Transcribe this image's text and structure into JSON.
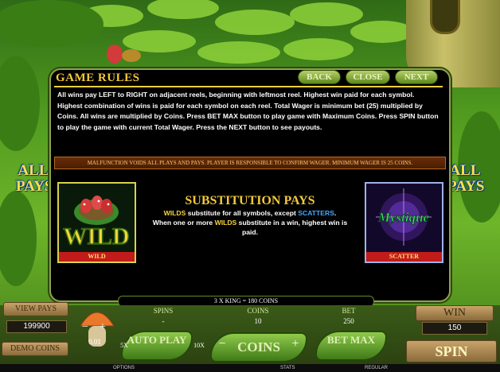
{
  "window": {
    "title": ""
  },
  "side": {
    "left_label": "ALL PAYS",
    "right_label": "ALL PAYS"
  },
  "rules": {
    "title": "GAME RULES",
    "nav": {
      "back": "BACK",
      "close": "CLOSE",
      "next": "NEXT"
    },
    "body": "All wins pay LEFT to RIGHT on adjacent reels, beginning with leftmost reel. Highest win paid for each symbol. Highest combination of wins is paid for each symbol on each reel. Total Wager is minimum bet (25) multiplied by Coins. All wins are multiplied by Coins. Press BET MAX button to play game with Maximum Coins. Press SPIN button to play the game with current Total Wager. Press the NEXT button to see payouts.",
    "malfunction": "MALFUNCTION VOIDS ALL PLAYS AND PAYS. PLAYER IS RESPONSIBLE TO CONFIRM WAGER. MINIMUM WAGER IS 25 COINS.",
    "wild_symbol": {
      "label": "WILD",
      "art_text": "WILD"
    },
    "scatter_symbol": {
      "label": "SCATTER",
      "art_text": "Mystique"
    },
    "substitution": {
      "title": "SUBSTITUTION PAYS",
      "line1_a": "WILDS",
      "line1_b": " substitute for all symbols, except ",
      "line1_c": "SCATTERS",
      "line1_d": ".",
      "line2_a": "When one or more ",
      "line2_b": "WILDS",
      "line2_c": " substitute in a win, highest win is paid."
    }
  },
  "footer_info": "3 X KING = 180 COINS",
  "controls": {
    "view_pays": "VIEW PAYS",
    "balance": "199900",
    "demo_coins": "DEMO COINS",
    "coin_value": "0.01",
    "spins_label": "SPINS",
    "spins_value": "-",
    "coins_label": "COINS",
    "coins_value": "10",
    "bet_label": "BET",
    "bet_value": "250",
    "win_label": "WIN",
    "win_value": "150",
    "auto_play": "AUTO PLAY",
    "x5": "5X",
    "x10": "10X",
    "coins_button": "COINS",
    "minus": "−",
    "plus": "+",
    "bet_max": "BET MAX",
    "spin": "SPIN"
  },
  "status_bar": {
    "options": "OPTIONS",
    "stats": "STATS",
    "regular": "REGULAR"
  },
  "colors": {
    "gold": "#f3c83a",
    "panel_bg": "#000000",
    "leaf_green": "#5fa020",
    "wild_blue": "#45a8ff"
  }
}
